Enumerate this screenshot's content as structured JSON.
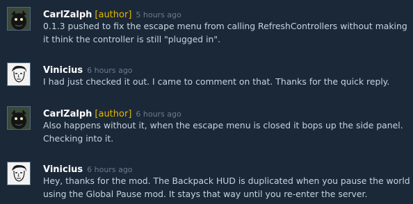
{
  "colors": {
    "background": "#1b2838",
    "author_tag": "#e6b800",
    "name": "#ffffff",
    "timestamp": "#6b7d8d",
    "text": "#c6d4df"
  },
  "comments": [
    {
      "author": "CarlZalph",
      "tag": "[author]",
      "time": "5 hours ago",
      "avatar_icon": "dark-creature-avatar",
      "text": "0.1.3 pushed to fix the escape menu from calling RefreshControllers without making it think the controller is still \"plugged in\"."
    },
    {
      "author": "Vinicius",
      "tag": "",
      "time": "6 hours ago",
      "avatar_icon": "sketch-face-avatar",
      "text": "I had just checked it out. I came to comment on that. Thanks for the quick reply."
    },
    {
      "author": "CarlZalph",
      "tag": "[author]",
      "time": "6 hours ago",
      "avatar_icon": "dark-creature-avatar",
      "text": "Also happens without it, when the escape menu is closed it bops up the side panel. Checking into it."
    },
    {
      "author": "Vinicius",
      "tag": "",
      "time": "6 hours ago",
      "avatar_icon": "sketch-face-avatar",
      "text": "Hey, thanks for the mod. The Backpack HUD is duplicated when you pause the world using the Global Pause mod. It stays that way until you re-enter the server."
    }
  ]
}
